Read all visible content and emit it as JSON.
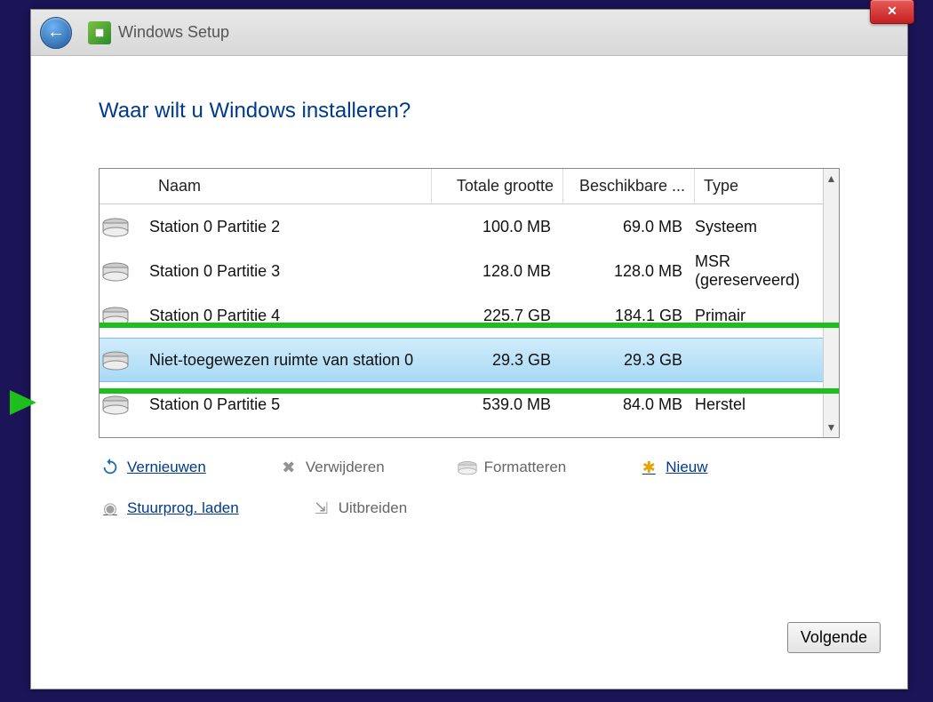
{
  "window": {
    "title": "Windows Setup",
    "heading": "Waar wilt u Windows installeren?",
    "close_label": "✕"
  },
  "columns": {
    "name": "Naam",
    "total": "Totale grootte",
    "avail": "Beschikbare ...",
    "type": "Type"
  },
  "rows": [
    {
      "name": "Station 0 Partitie 2",
      "total": "100.0 MB",
      "avail": "69.0 MB",
      "type": "Systeem",
      "selected": false
    },
    {
      "name": "Station 0 Partitie 3",
      "total": "128.0 MB",
      "avail": "128.0 MB",
      "type": "MSR (gereserveerd)",
      "selected": false
    },
    {
      "name": "Station 0 Partitie 4",
      "total": "225.7 GB",
      "avail": "184.1 GB",
      "type": "Primair",
      "selected": false
    },
    {
      "name": "Niet-toegewezen ruimte van station 0",
      "total": "29.3 GB",
      "avail": "29.3 GB",
      "type": "",
      "selected": true
    },
    {
      "name": "Station 0 Partitie 5",
      "total": "539.0 MB",
      "avail": "84.0 MB",
      "type": "Herstel",
      "selected": false
    }
  ],
  "actions": {
    "refresh": "Vernieuwen",
    "delete": "Verwijderen",
    "format": "Formatteren",
    "new": "Nieuw",
    "loaddrv": "Stuurprog. laden",
    "extend": "Uitbreiden"
  },
  "next": "Volgende"
}
